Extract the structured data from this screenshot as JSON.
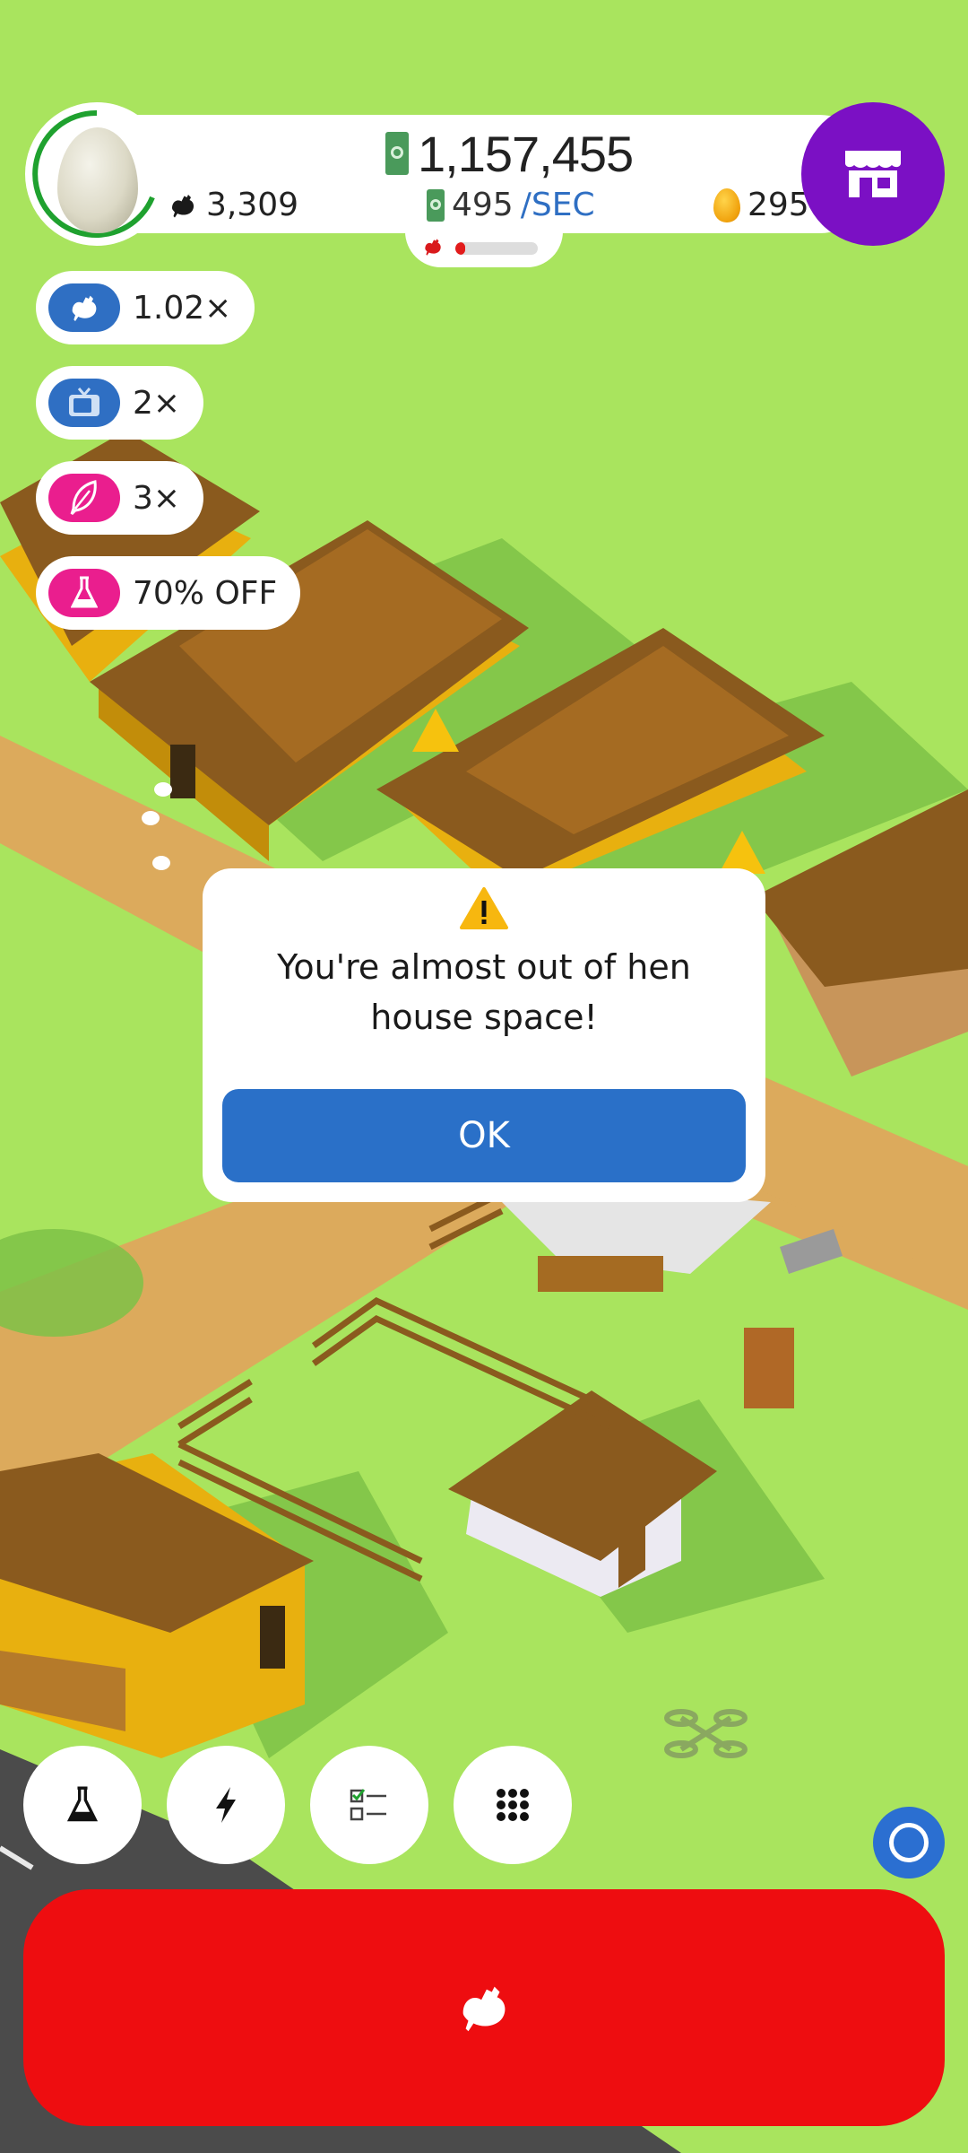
{
  "hud": {
    "money": "1,157,455",
    "rate_value": "495",
    "rate_unit": "/SEC",
    "hens": "3,309",
    "golden_eggs": "295",
    "drone_progress": 0.12
  },
  "boosts": [
    {
      "label": "1.02×",
      "icon": "chicken-icon",
      "color": "#2f6fc3"
    },
    {
      "label": "2×",
      "icon": "tv-icon",
      "color": "#2f6fc3"
    },
    {
      "label": "3×",
      "icon": "feather-icon",
      "color": "#ea1e8e"
    },
    {
      "label": "70% OFF",
      "icon": "flask-icon",
      "color": "#ea1e8e"
    }
  ],
  "dialog": {
    "message": "You're almost out of hen house space!",
    "ok_label": "OK"
  },
  "bottom_menu": [
    {
      "name": "research-button",
      "icon": "flask-icon"
    },
    {
      "name": "boosts-button",
      "icon": "lightning-icon"
    },
    {
      "name": "missions-button",
      "icon": "checklist-icon"
    },
    {
      "name": "menu-button",
      "icon": "grid-icon"
    }
  ],
  "colors": {
    "grass": "#a9e45e",
    "shop": "#7b10c4",
    "spawn": "#ee0d10",
    "ok": "#2a70c8"
  }
}
